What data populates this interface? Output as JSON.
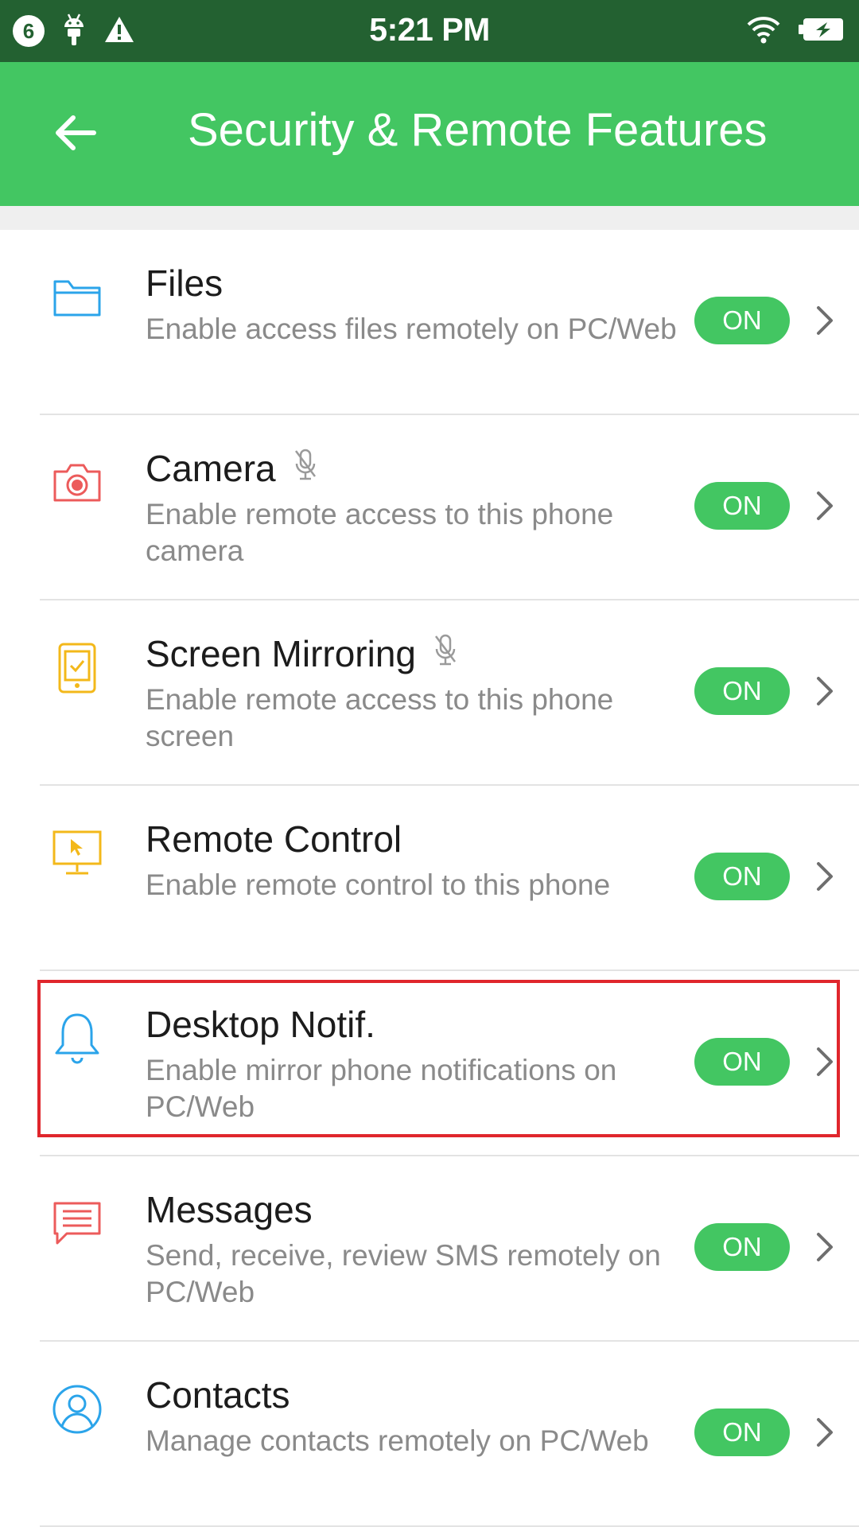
{
  "status_bar": {
    "notification_count": "6",
    "time": "5:21 PM",
    "icons": [
      "android-icon",
      "warning-icon",
      "wifi-icon",
      "battery-charging-icon"
    ]
  },
  "app_bar": {
    "title": "Security & Remote Features",
    "back_icon": "arrow-left-icon"
  },
  "features": [
    {
      "title": "Files",
      "description": "Enable access files remotely on PC/Web",
      "toggle": "ON",
      "icon": "folder-icon",
      "icon_color": "#2ba4ea",
      "mic": false
    },
    {
      "title": "Camera",
      "description": "Enable remote access to this phone camera",
      "toggle": "ON",
      "icon": "camera-icon",
      "icon_color": "#ec5b5b",
      "mic": true
    },
    {
      "title": "Screen Mirroring",
      "description": "Enable remote access to this phone screen",
      "toggle": "ON",
      "icon": "phone-screen-icon",
      "icon_color": "#f3b81a",
      "mic": true
    },
    {
      "title": "Remote Control",
      "description": "Enable remote control to this phone",
      "toggle": "ON",
      "icon": "monitor-cursor-icon",
      "icon_color": "#f3b81a",
      "mic": false
    },
    {
      "title": "Desktop Notif.",
      "description": "Enable mirror phone notifications on PC/Web",
      "toggle": "ON",
      "icon": "bell-icon",
      "icon_color": "#2ba4ea",
      "mic": false
    },
    {
      "title": "Messages",
      "description": "Send, receive, review SMS remotely on PC/Web",
      "toggle": "ON",
      "icon": "message-icon",
      "icon_color": "#ec5b5b",
      "mic": false
    },
    {
      "title": "Contacts",
      "description": "Manage contacts remotely on PC/Web",
      "toggle": "ON",
      "icon": "contact-icon",
      "icon_color": "#2ba4ea",
      "mic": false
    }
  ],
  "colors": {
    "status_bar": "#236131",
    "app_bar": "#43c662",
    "toggle_on": "#43c662",
    "highlight": "#e0262c"
  }
}
